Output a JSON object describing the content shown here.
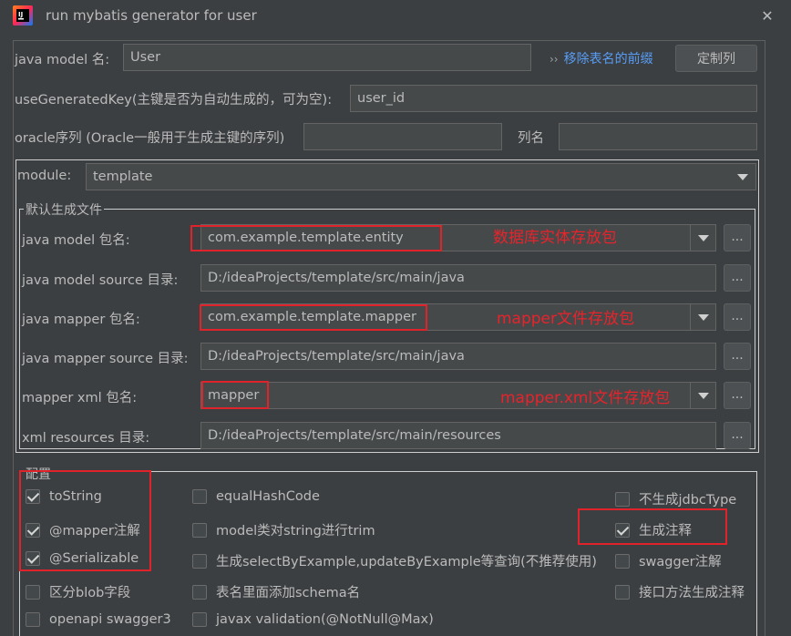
{
  "window": {
    "title": "run mybatis generator for user",
    "close_glyph": "✕"
  },
  "form": {
    "java_model_name_label": "java model 名:",
    "java_model_name_value": "User",
    "remove_prefix_link": "移除表名的前缀",
    "customize_columns_button": "定制列",
    "use_generated_key_label": "useGeneratedKey(主键是否为自动生成的，可为空):",
    "use_generated_key_value": "user_id",
    "oracle_sequence_label": "oracle序列 (Oracle一般用于生成主键的序列)",
    "oracle_sequence_value": "",
    "column_name_label": "列名",
    "column_name_value": "",
    "module_label": "module:",
    "module_value": "template"
  },
  "default_files": {
    "group_title": "默认生成文件",
    "rows": [
      {
        "label": "java model 包名:",
        "value": "com.example.template.entity",
        "note": "数据库实体存放包"
      },
      {
        "label": "java model source 目录:",
        "value": "D:/ideaProjects/template/src/main/java"
      },
      {
        "label": "java mapper 包名:",
        "value": "com.example.template.mapper",
        "note": "mapper文件存放包"
      },
      {
        "label": "java mapper source 目录:",
        "value": "D:/ideaProjects/template/src/main/java"
      },
      {
        "label": "mapper xml 包名:",
        "value": "mapper",
        "note": "mapper.xml文件存放包"
      },
      {
        "label": "xml resources 目录:",
        "value": "D:/ideaProjects/template/src/main/resources"
      }
    ],
    "browse_label": "..."
  },
  "config": {
    "group_title": "配置",
    "options": [
      {
        "label": "toString",
        "checked": true
      },
      {
        "label": "equalHashCode",
        "checked": false
      },
      {
        "label": "不生成jdbcType",
        "checked": false
      },
      {
        "label": "@mapper注解",
        "checked": true
      },
      {
        "label": "model类对string进行trim",
        "checked": false
      },
      {
        "label": "生成注释",
        "checked": true
      },
      {
        "label": "@Serializable",
        "checked": true
      },
      {
        "label": "生成selectByExample,updateByExample等查询(不推荐使用)",
        "checked": false
      },
      {
        "label": "swagger注解",
        "checked": false
      },
      {
        "label": "区分blob字段",
        "checked": false
      },
      {
        "label": "表名里面添加schema名",
        "checked": false
      },
      {
        "label": "接口方法生成注释",
        "checked": false
      },
      {
        "label": "openapi swagger3",
        "checked": false
      },
      {
        "label": "javax validation(@NotNull@Max)",
        "checked": false
      }
    ]
  },
  "colors": {
    "background": "#3c3f41",
    "field": "#45494a",
    "link": "#589df6",
    "annotation_red": "#e0232b"
  }
}
